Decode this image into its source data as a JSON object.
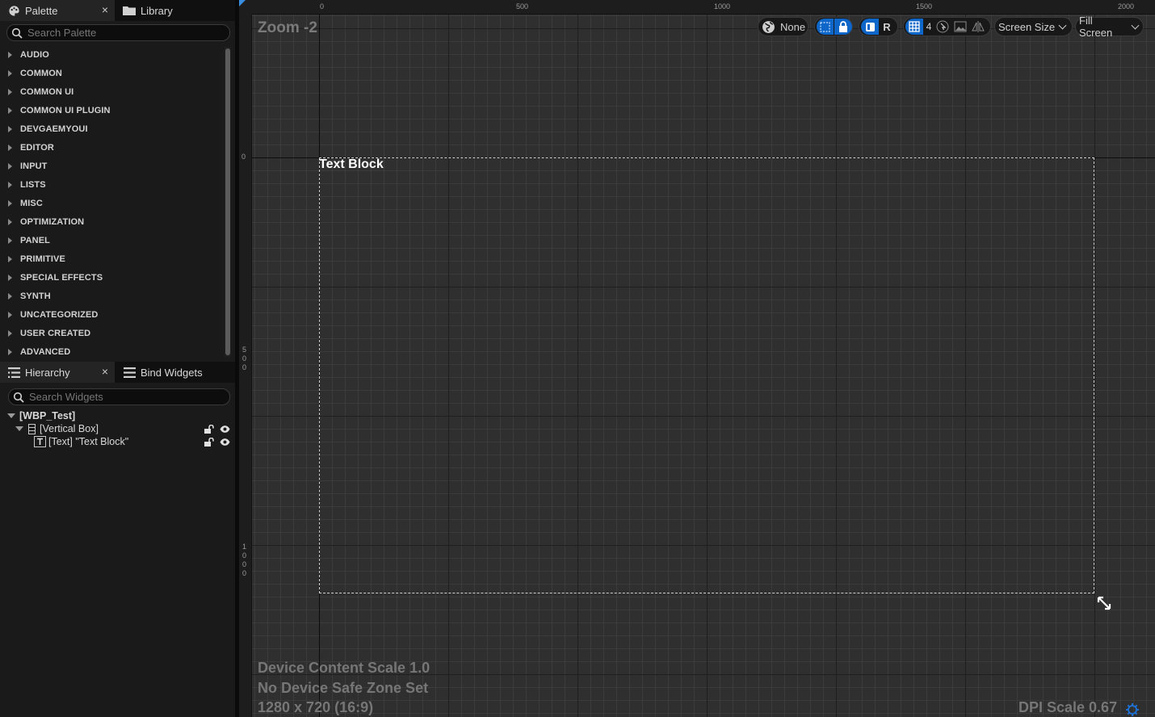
{
  "palette_tab": {
    "label": "Palette",
    "close": "×"
  },
  "library_tab": {
    "label": "Library"
  },
  "palette_search": {
    "placeholder": "Search Palette"
  },
  "palette_categories": [
    "AUDIO",
    "COMMON",
    "COMMON UI",
    "COMMON UI PLUGIN",
    "DEVGAEMYOUI",
    "EDITOR",
    "INPUT",
    "LISTS",
    "MISC",
    "OPTIMIZATION",
    "PANEL",
    "PRIMITIVE",
    "SPECIAL EFFECTS",
    "SYNTH",
    "UNCATEGORIZED",
    "USER CREATED",
    "ADVANCED"
  ],
  "hierarchy_tab": {
    "label": "Hierarchy",
    "close": "×"
  },
  "bind_tab": {
    "label": "Bind Widgets"
  },
  "widget_search": {
    "placeholder": "Search Widgets"
  },
  "tree": {
    "root": "[WBP_Test]",
    "vertical_box": "[Vertical Box]",
    "text": "[Text] \"Text Block\""
  },
  "canvas": {
    "zoom": "Zoom -2",
    "text_block": "Text Block",
    "device_scale": "Device Content Scale 1.0",
    "safe_zone": "No Device Safe Zone Set",
    "resolution": "1280 x 720 (16:9)",
    "dpi": "DPI Scale 0.67"
  },
  "rulers": {
    "top": [
      "0",
      "500",
      "1000",
      "1500",
      "2000"
    ],
    "left": [
      "0",
      "500",
      "1000"
    ]
  },
  "toolbar": {
    "localization": "None",
    "r_label": "R",
    "grid_size": "4",
    "screen_size": "Screen Size",
    "fill_screen": "Fill Screen"
  },
  "colors": {
    "accent": "#0e66c8",
    "panel": "#1a1a1a",
    "canvas": "#2f2f2f"
  }
}
